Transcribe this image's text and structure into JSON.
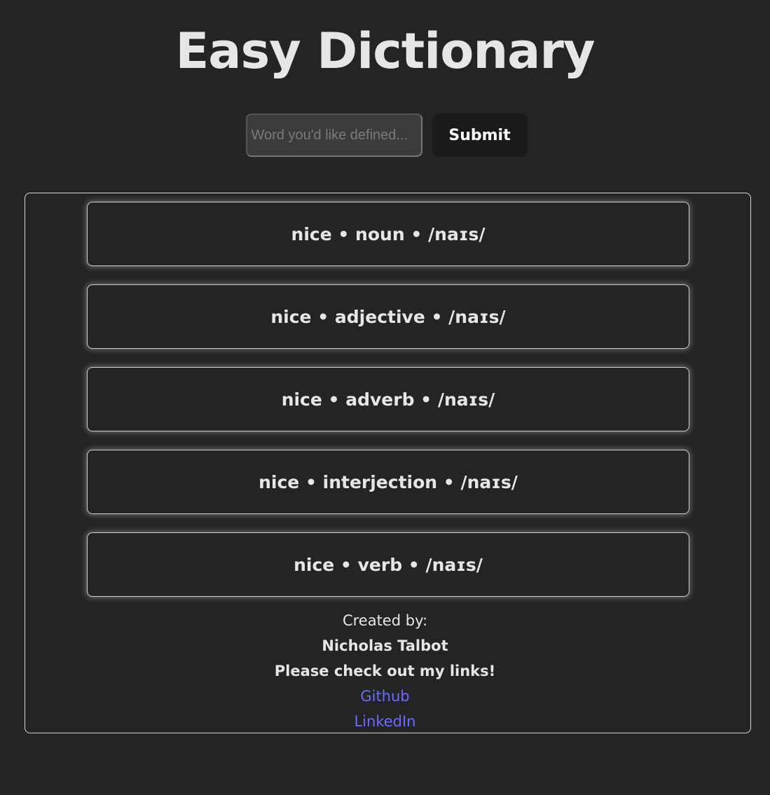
{
  "header": {
    "title": "Easy Dictionary"
  },
  "search": {
    "placeholder": "Word you'd like defined...",
    "value": "",
    "submit_label": "Submit"
  },
  "results": [
    {
      "label": "nice • noun • /naɪs/"
    },
    {
      "label": "nice • adjective • /naɪs/"
    },
    {
      "label": "nice • adverb • /naɪs/"
    },
    {
      "label": "nice • interjection • /naɪs/"
    },
    {
      "label": "nice • verb • /naɪs/"
    }
  ],
  "footer": {
    "created_by": "Created by:",
    "author": "Nicholas Talbot",
    "links_prompt": "Please check out my links!",
    "github_label": "Github",
    "linkedin_label": "LinkedIn"
  },
  "colors": {
    "background": "#242424",
    "text": "#e6e6e6",
    "link": "#6b6bff",
    "button": "#1a1a1a"
  }
}
